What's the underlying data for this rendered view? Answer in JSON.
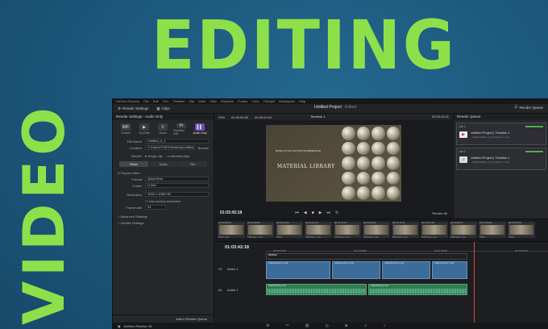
{
  "headline": {
    "top_word": "EDITING",
    "side_word": "VIDEO"
  },
  "app": {
    "menu": [
      "DaVinci Resolve",
      "File",
      "Edit",
      "Trim",
      "Timeline",
      "Clip",
      "Mark",
      "View",
      "Playback",
      "Fusion",
      "Color",
      "Fairlight",
      "Workspace",
      "Help"
    ],
    "toolbar": {
      "render_settings": "Render Settings",
      "clips": "Clips",
      "project_title": "Untitled Project",
      "edited_label": "Edited",
      "render_queue": "Render Queue"
    },
    "render_settings": {
      "header": "Render Settings - Audio Only",
      "presets": [
        {
          "icon": "IMF",
          "label": "Custom",
          "active": false
        },
        {
          "icon": "▶",
          "label": "YouTube",
          "active": false
        },
        {
          "icon": "V",
          "label": "Vimeo",
          "active": false
        },
        {
          "icon": "Pr",
          "label": "Premiere XML",
          "active": false
        },
        {
          "icon": "▌▌",
          "label": "Audio Only",
          "active": true
        }
      ],
      "file_name_label": "File Name",
      "file_name": "Untitled_0_1",
      "location_label": "Location",
      "location": "C:\\Users\\THEV\\Desktop\\untitled_0_1",
      "browse": "Browse",
      "render_label": "Render",
      "single_clip": "Single clip",
      "individual_clips": "Individual clips",
      "tabs": [
        "Video",
        "Audio",
        "File"
      ],
      "export_video": "Export Video",
      "format_label": "Format",
      "format": "QuickTime",
      "codec_label": "Codec",
      "codec": "H.264",
      "resolution_label": "Resolution",
      "resolution": "1920 x 1080 HD",
      "use_vertical": "Use vertical resolution",
      "frame_rate_label": "Frame rate",
      "frame_rate": "24",
      "advanced": "> Advanced Settings",
      "subtitle": "> Subtitle Settings",
      "add_button": "Add to Render Queue"
    },
    "viewer": {
      "zoom": "29%",
      "src_tc": "01:00:00:00",
      "dur_tc": "00:03:43:20",
      "timeline_name": "Timeline 1",
      "right_tc": "00:03:43:21",
      "frame_text_1": "BASE ACTUAL MOTION INTERMEDIATE",
      "frame_text_2": "MATERIAL LIBRARY",
      "transport_tc": "01:03:42:18",
      "render_all": "Render All"
    },
    "render_queue": {
      "header": "Render Queue",
      "jobs": [
        {
          "id": "Job 1",
          "icon": "▶",
          "title": "Untitled Project | Timeline 1",
          "sub": "...\\IMG\\Untitled_0_1\\Timeline 1.mp4"
        },
        {
          "id": "Job 2",
          "icon": "♫",
          "title": "Untitled Project | Timeline 1",
          "sub": "...\\IMG\\Untitled_0_1\\Timeline 1.mp3"
        }
      ]
    },
    "clip_strip": [
      {
        "tc": "00:00:08:00",
        "name": "FILE-1.mp4"
      },
      {
        "tc": "00:00:08:00",
        "name": "1080 Main I.mp4"
      },
      {
        "tc": "00:00:12:23",
        "name": "TRNS"
      },
      {
        "tc": "00:01:02:13",
        "name": "1080 Main I.mp4"
      },
      {
        "tc": "00:01:31:07",
        "name": "1080 Main I.mp4"
      },
      {
        "tc": "00:01:09:24",
        "name": "1080 Main I.mp4"
      },
      {
        "tc": "00:04:11:11",
        "name": "1080 Main I.mp4"
      },
      {
        "tc": "00:00:21:06",
        "name": "1080 Main I.mp4"
      },
      {
        "tc": "00:00:08:17",
        "name": "1080 Main I.mp4"
      },
      {
        "tc": "00:00:08:00",
        "name": "TRNS"
      },
      {
        "tc": "00:00:08:00",
        "name": "TRNS"
      }
    ],
    "timeline": {
      "timecode": "01:03:42:18",
      "ruler": [
        "01:00:24:00",
        "01:01:50:00",
        "01:02:42:00",
        "01:05:14:00"
      ],
      "tracks": [
        {
          "id": "V1",
          "name": "Video 1",
          "info": "10 Clips"
        },
        {
          "id": "A1",
          "name": "Audio 1",
          "info": "2.0"
        }
      ],
      "video_clip_label": "material texture 1.png",
      "audio_clip_label": "material library.mp3",
      "render_title": "RENDER",
      "render_mode": "Entire Timeline"
    },
    "bottom": {
      "brand": "DaVinci Resolve 18",
      "pages": [
        "⚙",
        "✂",
        "▤",
        "◎",
        "◈",
        "♫",
        "➶"
      ]
    }
  }
}
